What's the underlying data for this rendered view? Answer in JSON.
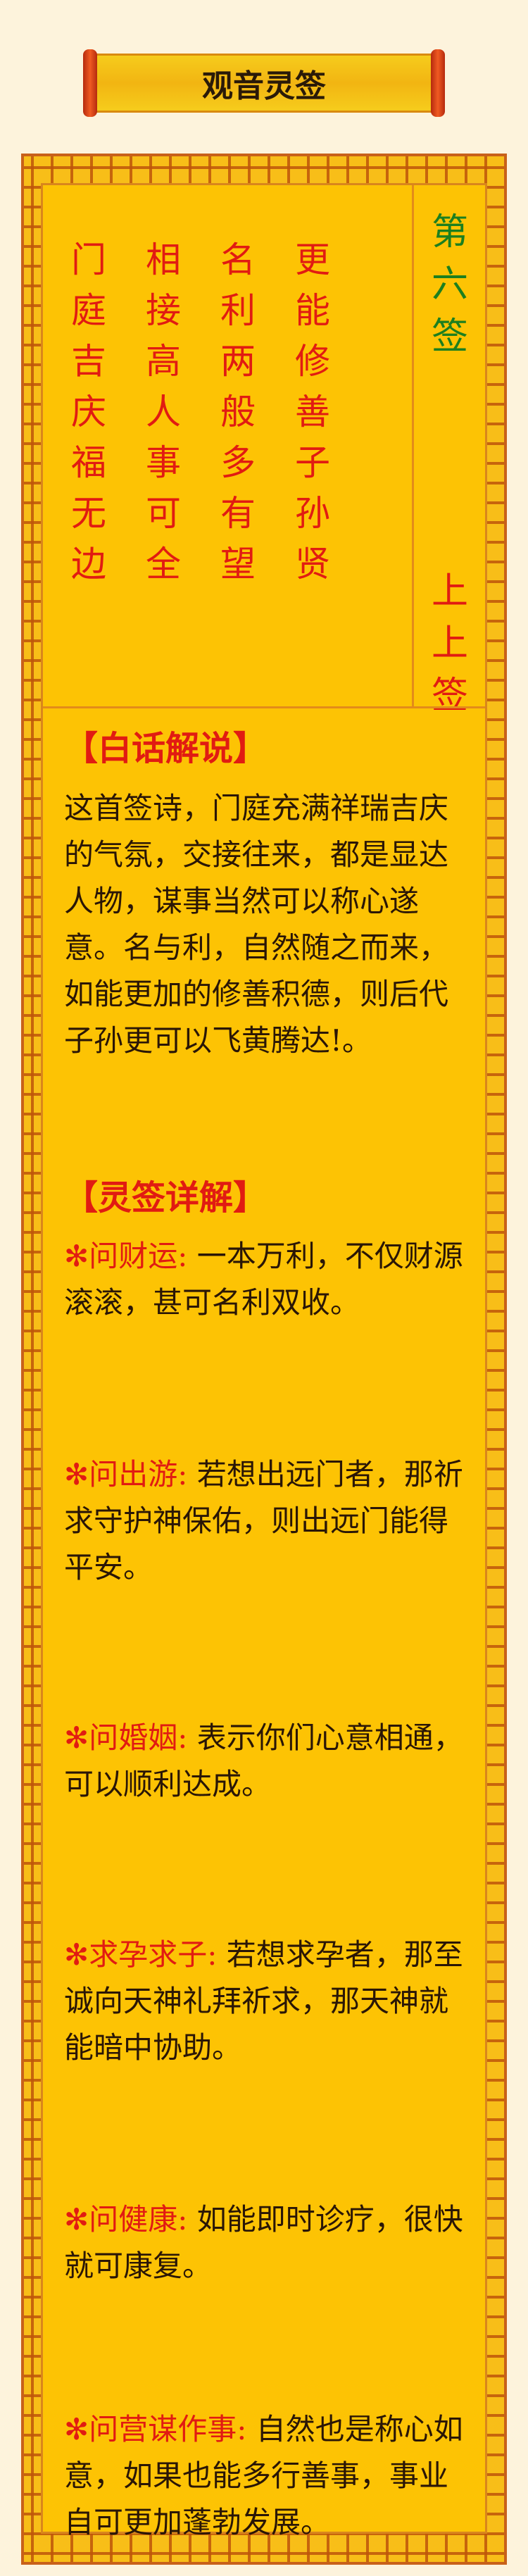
{
  "header": {
    "title": "观音灵签"
  },
  "poem": {
    "columns": [
      [
        "门",
        "庭",
        "吉",
        "庆",
        "福",
        "无",
        "边"
      ],
      [
        "相",
        "接",
        "高",
        "人",
        "事",
        "可",
        "全"
      ],
      [
        "名",
        "利",
        "两",
        "般",
        "多",
        "有",
        "望"
      ],
      [
        "更",
        "能",
        "修",
        "善",
        "子",
        "孙",
        "贤"
      ]
    ],
    "sign_number": [
      "第",
      "六",
      "签"
    ],
    "sign_level": [
      "上",
      "上",
      "签"
    ]
  },
  "plain": {
    "heading": "【白话解说】",
    "text": "这首签诗，门庭充满祥瑞吉庆的气氛，交接往来，都是显达人物，谋事当然可以称心遂意。名与利，自然随之而来，如能更加的修善积德，则后代子孙更可以飞黄腾达!。"
  },
  "detail": {
    "heading": "【灵签详解】",
    "items": [
      {
        "star": "✻",
        "label": "问财运:",
        "text": "一本万利，不仅财源滚滚，甚可名利双收。"
      },
      {
        "star": "✻",
        "label": "问出游:",
        "text": "若想出远门者，那祈求守护神保佑，则出远门能得平安。"
      },
      {
        "star": "✻",
        "label": "问婚姻:",
        "text": "表示你们心意相通，可以顺利达成。"
      },
      {
        "star": "✻",
        "label": "求孕求子:",
        "text": "若想求孕者，那至诚向天神礼拜祈求，那天神就能暗中协助。"
      },
      {
        "star": "✻",
        "label": "问健康:",
        "text": "如能即时诊疗，很快就可康复。"
      },
      {
        "star": "✻",
        "label": "问营谋作事:",
        "text": "自然也是称心如意，如果也能多行善事，事业自可更加蓬勃发展。"
      }
    ]
  }
}
